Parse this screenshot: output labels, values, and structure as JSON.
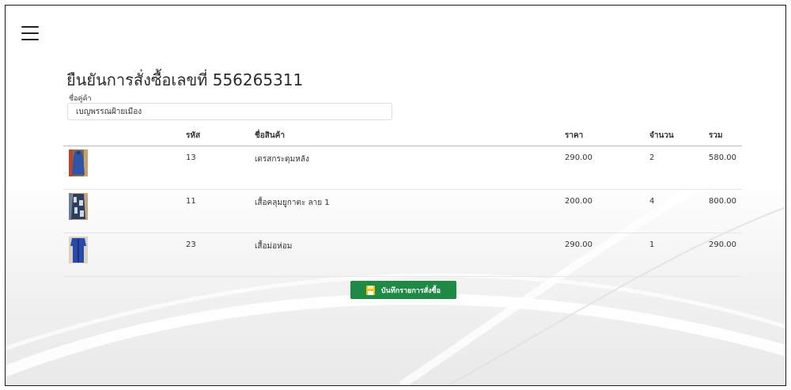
{
  "menu": {
    "icon": "hamburger-icon"
  },
  "order": {
    "title": "ยืนยันการสั่งซื้อเลขที่ 556265311",
    "partner_label": "ชื่อคู่ค้า",
    "partner_value": "เบญพรรณฝ้ายเมือง"
  },
  "table": {
    "headers": {
      "code": "รหัส",
      "name": "ชื่อสินค้า",
      "price": "ราคา",
      "qty": "จำนวน",
      "total": "รวม"
    },
    "rows": [
      {
        "image": "blue-dress-thumbnail",
        "code": "13",
        "name": "เดรสกระดุมหลัง",
        "price": "290.00",
        "qty": "2",
        "total": "580.00"
      },
      {
        "image": "ikat-shawl-thumbnail",
        "code": "11",
        "name": "เสื้อคลุมยูกาตะ ลาย 1",
        "price": "200.00",
        "qty": "4",
        "total": "800.00"
      },
      {
        "image": "mor-hom-shirt-thumbnail",
        "code": "23",
        "name": "เสื้อม่อห่อม",
        "price": "290.00",
        "qty": "1",
        "total": "290.00"
      }
    ]
  },
  "actions": {
    "save_label": "บันทึกรายการสั่งซื้อ",
    "save_icon": "floppy-disk-icon"
  },
  "colors": {
    "button": "#1e8a46",
    "icon_yellow": "#f2c21a",
    "product_blue": "#2f55a8"
  }
}
